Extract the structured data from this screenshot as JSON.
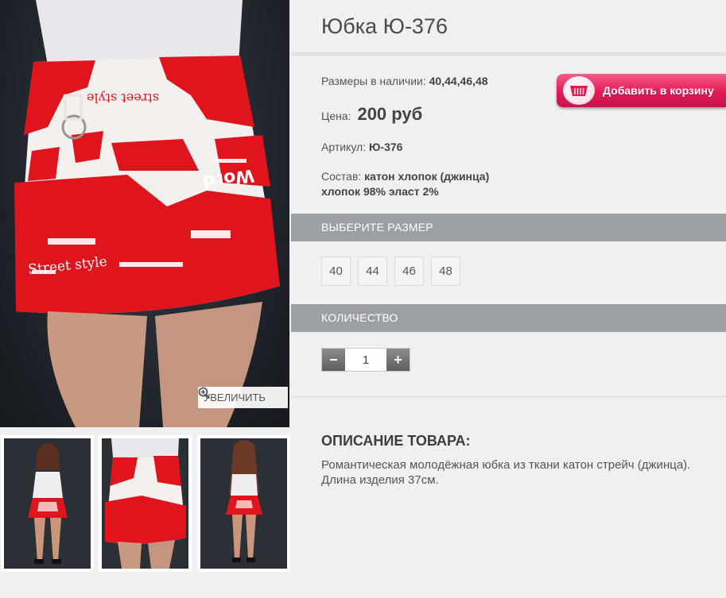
{
  "product": {
    "title": "Юбка Ю-376",
    "sizes_label": "Размеры в наличии:",
    "sizes_value": "40,44,46,48",
    "price_label": "Цена:",
    "price_value": "200 руб",
    "sku_label": "Артикул:",
    "sku_value": "Ю-376",
    "composition_label": "Состав:",
    "composition_line1": "катон хлопок (джинца)",
    "composition_line2": "хлопок 98% эласт 2%"
  },
  "gallery": {
    "zoom_label": "УВЕЛИЧИТЬ",
    "zoom_icon": "magnifier-plus-icon"
  },
  "cart": {
    "button_label": "Добавить в корзину",
    "icon": "basket-icon",
    "accent": "#e31a56"
  },
  "size_section": {
    "title": "ВЫБЕРИТЕ РАЗМЕР",
    "options": [
      "40",
      "44",
      "46",
      "48"
    ]
  },
  "quantity_section": {
    "title": "КОЛИЧЕСТВО",
    "minus": "−",
    "plus": "+",
    "value": "1"
  },
  "description": {
    "heading": "ОПИСАНИЕ ТОВАРА:",
    "text": "Романтическая молодёжная юбка из ткани катон стрейч (джинца). Длина изделия 37см."
  },
  "colors": {
    "section_bar": "#9c9fa3",
    "background": "#f0f0f0",
    "skirt_red": "#e0141c"
  }
}
